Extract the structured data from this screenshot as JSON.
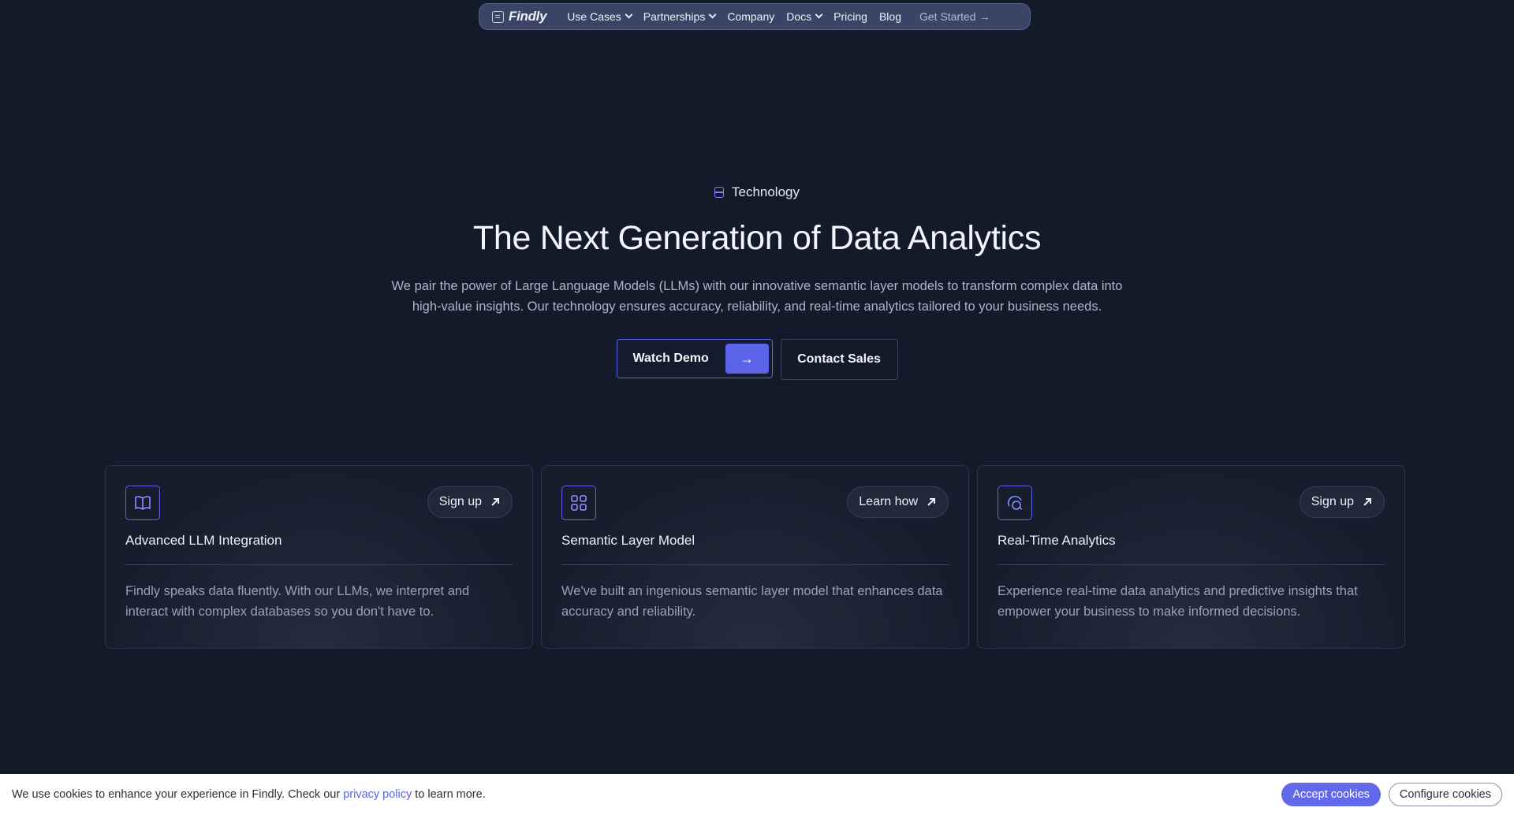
{
  "nav": {
    "brand": "Findly",
    "items": [
      {
        "label": "Use Cases",
        "has_dropdown": true
      },
      {
        "label": "Partnerships",
        "has_dropdown": true
      },
      {
        "label": "Company",
        "has_dropdown": false
      },
      {
        "label": "Docs",
        "has_dropdown": true
      },
      {
        "label": "Pricing",
        "has_dropdown": false
      },
      {
        "label": "Blog",
        "has_dropdown": false
      }
    ],
    "cta": "Get Started",
    "cta_arrow": "→"
  },
  "hero": {
    "eyebrow": "Technology",
    "title": "The Next Generation of Data Analytics",
    "subtitle_line1": "We pair the power of Large Language Models (LLMs) with our innovative semantic layer models to transform complex data into",
    "subtitle_line2": "high-value insights. Our technology ensures accuracy, reliability, and real-time analytics tailored to your business needs.",
    "primary_button": "Watch Demo",
    "primary_arrow": "→",
    "secondary_button": "Contact Sales"
  },
  "cards": [
    {
      "icon": "book-icon",
      "action": "Sign up",
      "title": "Advanced LLM Integration",
      "description": "Findly speaks data fluently. With our LLMs, we interpret and interact with complex databases so you don't have to."
    },
    {
      "icon": "grid-icon",
      "action": "Learn how",
      "title": "Semantic Layer Model",
      "description": "We've built an ingenious semantic layer model that enhances data accuracy and reliability."
    },
    {
      "icon": "chat-icon",
      "action": "Sign up",
      "title": "Real-Time Analytics",
      "description": "Experience real-time data analytics and predictive insights that empower your business to make informed decisions."
    }
  ],
  "cookie": {
    "text_before": "We use cookies to enhance your experience in Findly. Check our",
    "link": "privacy policy",
    "text_after": "to learn more.",
    "accept": "Accept cookies",
    "configure": "Configure cookies"
  },
  "colors": {
    "background": "#131b2b",
    "accent": "#5b63e8",
    "nav_bg": "#3a4466"
  }
}
